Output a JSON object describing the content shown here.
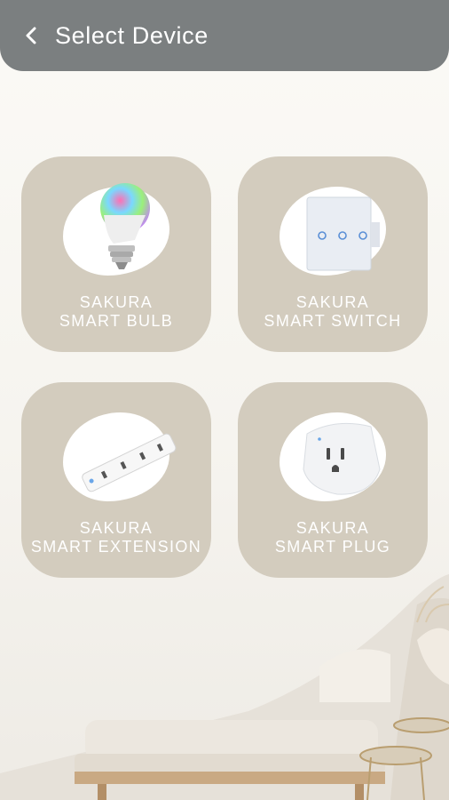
{
  "header": {
    "title": "Select Device",
    "back_icon": "chevron-left-icon"
  },
  "devices": [
    {
      "line1": "SAKURA",
      "line2": "SMART BULB",
      "icon": "smart-bulb-image"
    },
    {
      "line1": "SAKURA",
      "line2": "SMART SWITCH",
      "icon": "smart-switch-image"
    },
    {
      "line1": "SAKURA",
      "line2": "SMART EXTENSION",
      "icon": "smart-extension-image"
    },
    {
      "line1": "SAKURA",
      "line2": "SMART PLUG",
      "icon": "smart-plug-image"
    }
  ],
  "colors": {
    "header": "#7b7f80",
    "card": "#d3ccbe",
    "text": "#ffffff"
  }
}
